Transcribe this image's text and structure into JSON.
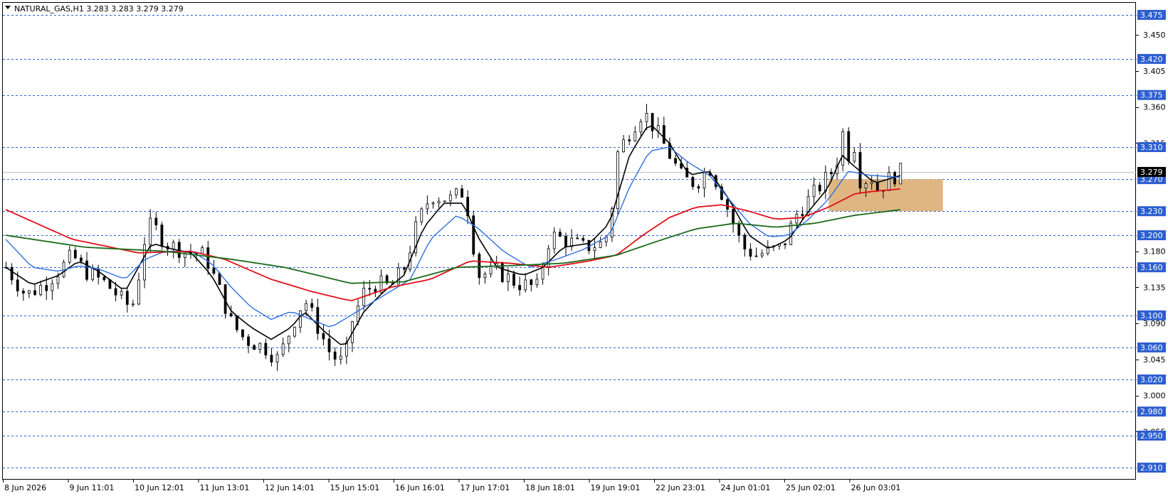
{
  "header": {
    "symbol_line": "NATURAL_GAS,H1  3.283 3.283 3.279 3.279"
  },
  "colors": {
    "background": "#ffffff",
    "candle": "#000000",
    "grid_level": "#2e5fd0",
    "level_label_bg": "#2e5fd0",
    "current_price_bg": "#000000",
    "ma_fast": "#000000",
    "ma_blue": "#2e6fe0",
    "ma_red": "#e0101a",
    "ma_green": "#1a6a1a",
    "zone_fill": "#d9a96c"
  },
  "chart_data": {
    "type": "candlestick",
    "title": "NATURAL_GAS,H1",
    "ohlc_last": {
      "open": 3.283,
      "high": 3.283,
      "low": 3.279,
      "close": 3.279
    },
    "current_price": "3.279",
    "y_range": [
      2.895,
      3.49
    ],
    "y_tick_labels": [
      "3.450",
      "3.405",
      "3.360",
      "3.315",
      "3.180",
      "3.135",
      "3.090",
      "3.045",
      "3.000",
      "2.955"
    ],
    "x_tick_labels": [
      "8 Jun 2026",
      "9 Jun 11:01",
      "10 Jun 12:01",
      "11 Jun 13:01",
      "12 Jun 14:01",
      "15 Jun 15:01",
      "16 Jun 16:01",
      "17 Jun 17:01",
      "18 Jun 18:01",
      "19 Jun 19:01",
      "22 Jun 23:01",
      "24 Jun 01:01",
      "25 Jun 02:01",
      "26 Jun 03:01"
    ],
    "horizontal_levels": [
      "3.475",
      "3.420",
      "3.375",
      "3.310",
      "3.270",
      "3.230",
      "3.200",
      "3.160",
      "3.100",
      "3.060",
      "3.020",
      "2.980",
      "2.950",
      "2.910"
    ],
    "zone": {
      "upper": 3.27,
      "lower": 3.23,
      "start_index": 124,
      "extends_past_last": 6
    },
    "price_path": [
      [
        0,
        3.16
      ],
      [
        3,
        3.125
      ],
      [
        6,
        3.14
      ],
      [
        9,
        3.165
      ],
      [
        10,
        3.175
      ],
      [
        12,
        3.155
      ],
      [
        15,
        3.14
      ],
      [
        18,
        3.115
      ],
      [
        19,
        3.11
      ],
      [
        20,
        3.15
      ],
      [
        21,
        3.2
      ],
      [
        22,
        3.215
      ],
      [
        24,
        3.19
      ],
      [
        27,
        3.18
      ],
      [
        30,
        3.175
      ],
      [
        32,
        3.135
      ],
      [
        34,
        3.09
      ],
      [
        36,
        3.07
      ],
      [
        39,
        3.06
      ],
      [
        41,
        3.045
      ],
      [
        42,
        3.065
      ],
      [
        44,
        3.105
      ],
      [
        45,
        3.12
      ],
      [
        47,
        3.085
      ],
      [
        49,
        3.05
      ],
      [
        51,
        3.04
      ],
      [
        52,
        3.09
      ],
      [
        54,
        3.13
      ],
      [
        56,
        3.14
      ],
      [
        58,
        3.135
      ],
      [
        60,
        3.16
      ],
      [
        62,
        3.215
      ],
      [
        64,
        3.25
      ],
      [
        67,
        3.245
      ],
      [
        69,
        3.255
      ],
      [
        70,
        3.215
      ],
      [
        71,
        3.15
      ],
      [
        74,
        3.155
      ],
      [
        77,
        3.14
      ],
      [
        80,
        3.135
      ],
      [
        82,
        3.2
      ],
      [
        84,
        3.195
      ],
      [
        87,
        3.185
      ],
      [
        90,
        3.19
      ],
      [
        91,
        3.21
      ],
      [
        92,
        3.3
      ],
      [
        94,
        3.33
      ],
      [
        96,
        3.355
      ],
      [
        98,
        3.33
      ],
      [
        100,
        3.3
      ],
      [
        102,
        3.27
      ],
      [
        104,
        3.265
      ],
      [
        106,
        3.285
      ],
      [
        108,
        3.25
      ],
      [
        110,
        3.205
      ],
      [
        111,
        3.185
      ],
      [
        113,
        3.175
      ],
      [
        115,
        3.18
      ],
      [
        117,
        3.185
      ],
      [
        119,
        3.225
      ],
      [
        121,
        3.245
      ],
      [
        123,
        3.265
      ],
      [
        125,
        3.285
      ],
      [
        126,
        3.33
      ],
      [
        127,
        3.3
      ],
      [
        128,
        3.315
      ],
      [
        129,
        3.25
      ],
      [
        130,
        3.285
      ],
      [
        131,
        3.255
      ],
      [
        133,
        3.27
      ],
      [
        135,
        3.28
      ]
    ],
    "series": [
      {
        "values": [
          [
            0,
            3.16
          ],
          [
            4,
            3.138
          ],
          [
            8,
            3.15
          ],
          [
            11,
            3.168
          ],
          [
            14,
            3.155
          ],
          [
            18,
            3.13
          ],
          [
            20,
            3.16
          ],
          [
            22,
            3.19
          ],
          [
            25,
            3.183
          ],
          [
            28,
            3.178
          ],
          [
            31,
            3.15
          ],
          [
            34,
            3.105
          ],
          [
            37,
            3.085
          ],
          [
            40,
            3.07
          ],
          [
            43,
            3.085
          ],
          [
            45,
            3.105
          ],
          [
            48,
            3.08
          ],
          [
            51,
            3.06
          ],
          [
            54,
            3.105
          ],
          [
            57,
            3.13
          ],
          [
            60,
            3.15
          ],
          [
            63,
            3.21
          ],
          [
            66,
            3.24
          ],
          [
            69,
            3.24
          ],
          [
            71,
            3.2
          ],
          [
            74,
            3.16
          ],
          [
            78,
            3.15
          ],
          [
            81,
            3.16
          ],
          [
            84,
            3.185
          ],
          [
            88,
            3.19
          ],
          [
            91,
            3.215
          ],
          [
            94,
            3.3
          ],
          [
            97,
            3.34
          ],
          [
            100,
            3.315
          ],
          [
            103,
            3.275
          ],
          [
            106,
            3.28
          ],
          [
            109,
            3.245
          ],
          [
            112,
            3.2
          ],
          [
            115,
            3.183
          ],
          [
            118,
            3.195
          ],
          [
            121,
            3.23
          ],
          [
            124,
            3.26
          ],
          [
            126,
            3.3
          ],
          [
            128,
            3.285
          ],
          [
            131,
            3.265
          ],
          [
            135,
            3.275
          ]
        ]
      },
      {
        "values": [
          [
            0,
            3.195
          ],
          [
            4,
            3.16
          ],
          [
            8,
            3.155
          ],
          [
            11,
            3.162
          ],
          [
            14,
            3.158
          ],
          [
            18,
            3.145
          ],
          [
            21,
            3.17
          ],
          [
            24,
            3.18
          ],
          [
            28,
            3.18
          ],
          [
            31,
            3.165
          ],
          [
            34,
            3.135
          ],
          [
            37,
            3.11
          ],
          [
            40,
            3.095
          ],
          [
            43,
            3.105
          ],
          [
            46,
            3.095
          ],
          [
            49,
            3.085
          ],
          [
            53,
            3.105
          ],
          [
            57,
            3.125
          ],
          [
            61,
            3.145
          ],
          [
            64,
            3.195
          ],
          [
            68,
            3.225
          ],
          [
            71,
            3.21
          ],
          [
            75,
            3.18
          ],
          [
            79,
            3.16
          ],
          [
            83,
            3.17
          ],
          [
            87,
            3.182
          ],
          [
            91,
            3.2
          ],
          [
            94,
            3.26
          ],
          [
            97,
            3.305
          ],
          [
            100,
            3.31
          ],
          [
            103,
            3.29
          ],
          [
            106,
            3.275
          ],
          [
            109,
            3.245
          ],
          [
            112,
            3.215
          ],
          [
            115,
            3.198
          ],
          [
            118,
            3.2
          ],
          [
            121,
            3.22
          ],
          [
            124,
            3.245
          ],
          [
            127,
            3.28
          ],
          [
            130,
            3.275
          ],
          [
            135,
            3.272
          ]
        ]
      },
      {
        "values": [
          [
            0,
            3.232
          ],
          [
            10,
            3.195
          ],
          [
            20,
            3.178
          ],
          [
            28,
            3.18
          ],
          [
            33,
            3.17
          ],
          [
            40,
            3.145
          ],
          [
            46,
            3.13
          ],
          [
            52,
            3.118
          ],
          [
            58,
            3.135
          ],
          [
            64,
            3.145
          ],
          [
            70,
            3.168
          ],
          [
            76,
            3.165
          ],
          [
            82,
            3.16
          ],
          [
            88,
            3.168
          ],
          [
            92,
            3.175
          ],
          [
            96,
            3.2
          ],
          [
            100,
            3.222
          ],
          [
            104,
            3.235
          ],
          [
            108,
            3.238
          ],
          [
            112,
            3.23
          ],
          [
            116,
            3.22
          ],
          [
            120,
            3.222
          ],
          [
            124,
            3.235
          ],
          [
            128,
            3.252
          ],
          [
            131,
            3.255
          ],
          [
            135,
            3.258
          ]
        ]
      },
      {
        "values": [
          [
            0,
            3.2
          ],
          [
            12,
            3.185
          ],
          [
            24,
            3.18
          ],
          [
            34,
            3.17
          ],
          [
            42,
            3.16
          ],
          [
            52,
            3.14
          ],
          [
            60,
            3.142
          ],
          [
            68,
            3.16
          ],
          [
            76,
            3.162
          ],
          [
            84,
            3.165
          ],
          [
            92,
            3.175
          ],
          [
            98,
            3.192
          ],
          [
            104,
            3.208
          ],
          [
            110,
            3.215
          ],
          [
            116,
            3.21
          ],
          [
            122,
            3.215
          ],
          [
            128,
            3.225
          ],
          [
            135,
            3.232
          ]
        ]
      }
    ]
  }
}
